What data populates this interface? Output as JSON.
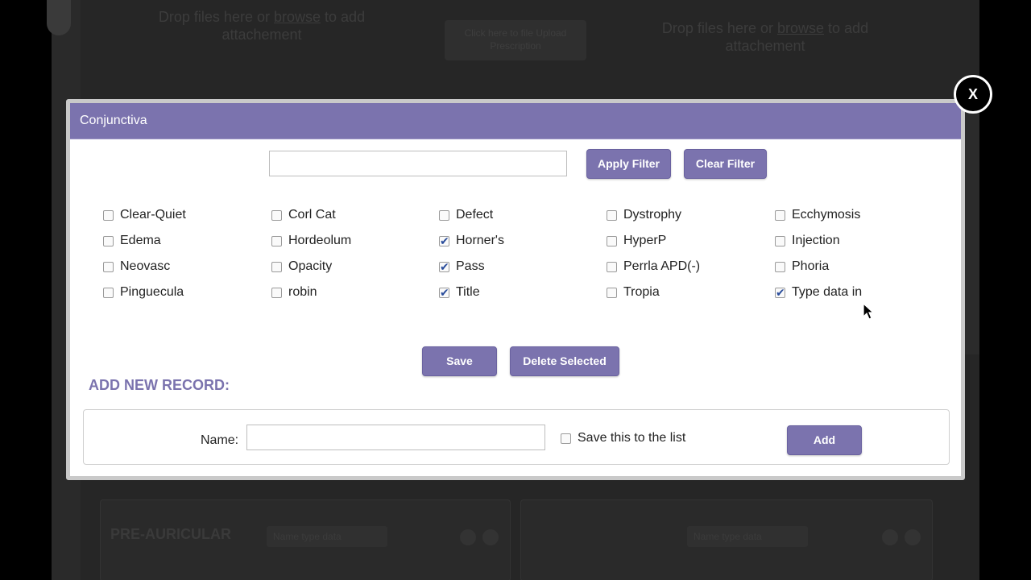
{
  "background": {
    "drop_text_1": "Drop files here or",
    "drop_link_1": "browse",
    "drop_suffix_1": "to add attachement",
    "drop_text_2": "Drop files here or",
    "drop_link_2": "browse",
    "drop_suffix_2": "to add attachement",
    "center_button": "Click here to file Upload Prescription",
    "panel_title": "PRE-AURICULAR",
    "panel_field_1": "Name type data",
    "panel_field_2": "Name type data"
  },
  "modal": {
    "title": "Conjunctiva",
    "close_label": "X",
    "filter": {
      "value": "",
      "placeholder": "",
      "apply_label": "Apply Filter",
      "clear_label": "Clear Filter"
    },
    "options": [
      {
        "label": "Clear-Quiet",
        "checked": false
      },
      {
        "label": "Corl Cat",
        "checked": false
      },
      {
        "label": "Defect",
        "checked": false
      },
      {
        "label": "Dystrophy",
        "checked": false
      },
      {
        "label": "Ecchymosis",
        "checked": false
      },
      {
        "label": "Edema",
        "checked": false
      },
      {
        "label": "Hordeolum",
        "checked": false
      },
      {
        "label": "Horner's",
        "checked": true
      },
      {
        "label": "HyperP",
        "checked": false
      },
      {
        "label": "Injection",
        "checked": false
      },
      {
        "label": "Neovasc",
        "checked": false
      },
      {
        "label": "Opacity",
        "checked": false
      },
      {
        "label": "Pass",
        "checked": true
      },
      {
        "label": "Perrla APD(-)",
        "checked": false
      },
      {
        "label": "Phoria",
        "checked": false
      },
      {
        "label": "Pinguecula",
        "checked": false
      },
      {
        "label": "robin",
        "checked": false
      },
      {
        "label": "Title",
        "checked": true
      },
      {
        "label": "Tropia",
        "checked": false
      },
      {
        "label": "Type data in",
        "checked": true
      }
    ],
    "save_label": "Save",
    "delete_label": "Delete Selected",
    "add_record": {
      "title": "ADD NEW RECORD:",
      "name_label": "Name:",
      "name_value": "",
      "save_to_list_label": "Save this to the list",
      "save_to_list_checked": false,
      "add_label": "Add"
    }
  },
  "colors": {
    "accent": "#7b73ae",
    "check": "#2a4d9b"
  }
}
